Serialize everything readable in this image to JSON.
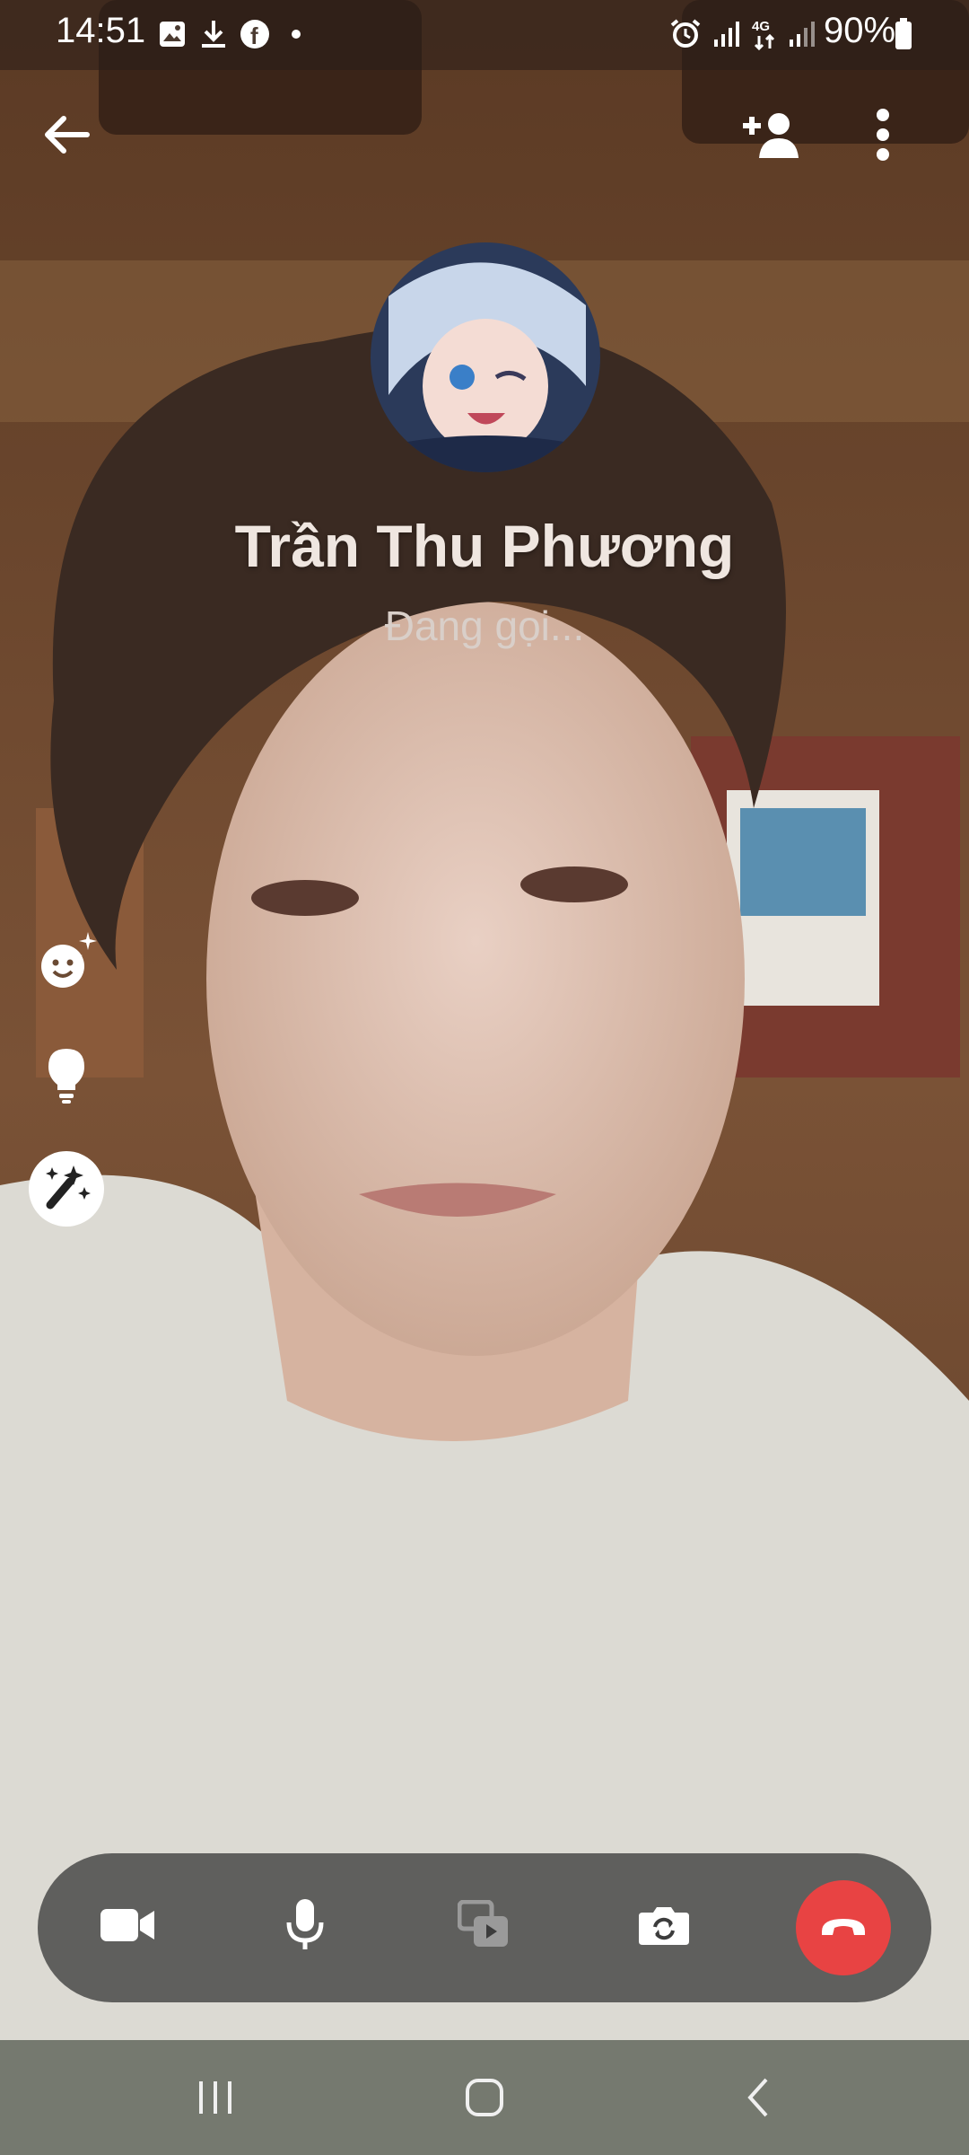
{
  "status_bar": {
    "time": "14:51",
    "battery": "90%",
    "left_icons": [
      "image-icon",
      "download-icon",
      "facebook-icon",
      "dot-icon"
    ],
    "right_icons": [
      "alarm-icon",
      "signal-icon",
      "4g-icon",
      "signal-icon",
      "battery-icon"
    ]
  },
  "top_bar": {
    "back_icon": "arrow-left-icon",
    "add_person_icon": "add-person-icon",
    "more_icon": "more-vertical-icon"
  },
  "call": {
    "name": "Trần Thu Phương",
    "status": "Đang gọi..."
  },
  "side_effects": [
    "emoji-sparkle-icon",
    "lightbulb-icon",
    "magic-wand-icon"
  ],
  "call_controls": [
    "video-camera-icon",
    "microphone-icon",
    "share-media-icon",
    "flip-camera-icon",
    "end-call-icon"
  ],
  "colors": {
    "end_call": "#e84343",
    "control_bar": "#3c3c3c"
  },
  "nav_bar": [
    "recent-apps-icon",
    "home-icon",
    "back-icon"
  ]
}
